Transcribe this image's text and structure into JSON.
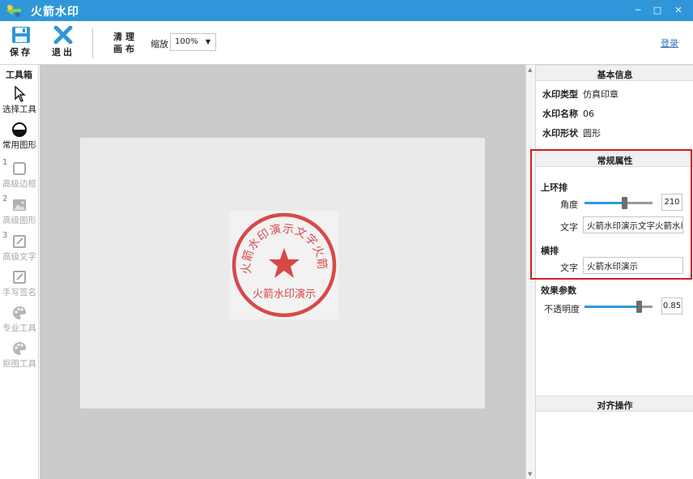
{
  "app": {
    "title": "火箭水印"
  },
  "window_controls": {
    "minimize": "─",
    "maximize": "□",
    "close": "✕"
  },
  "toolbar": {
    "save_label": "保存",
    "exit_label": "退出",
    "clear_label_1": "清理",
    "clear_label_2": "画布",
    "zoom_label": "缩放",
    "zoom_value": "100%",
    "login_label": "登录"
  },
  "toolbox": {
    "title": "工具箱",
    "items": [
      {
        "label": "选择工具",
        "icon": "cursor-arrow-icon",
        "enabled": true
      },
      {
        "label": "常用图形",
        "icon": "circle-shape-icon",
        "enabled": true
      },
      {
        "label": "高级边框",
        "icon": "square-frame-icon",
        "enabled": false,
        "number": "1"
      },
      {
        "label": "高级图形",
        "icon": "image-icon",
        "enabled": false,
        "number": "2"
      },
      {
        "label": "高级文字",
        "icon": "edit-text-icon",
        "enabled": false,
        "number": "3"
      },
      {
        "label": "手写签名",
        "icon": "pen-signature-icon",
        "enabled": false
      },
      {
        "label": "专业工具",
        "icon": "palette-icon",
        "enabled": false
      },
      {
        "label": "抠图工具",
        "icon": "palette-cutout-icon",
        "enabled": false
      }
    ]
  },
  "canvas": {
    "stamp": {
      "top_text": "火箭水印演示文字火箭水印",
      "bottom_text": "火箭水印演示",
      "color": "#d42a2a"
    }
  },
  "panel": {
    "basic_info": {
      "title": "基本信息",
      "rows": [
        {
          "label": "水印类型",
          "value": "仿真印章"
        },
        {
          "label": "水印名称",
          "value": "06"
        },
        {
          "label": "水印形状",
          "value": "圆形"
        }
      ]
    },
    "general_props": {
      "title": "常规属性",
      "upper_ring": {
        "title": "上环排",
        "angle_label": "角度",
        "angle_value": "210",
        "angle_fraction": 0.58,
        "text_label": "文字",
        "text_value": "火箭水印演示文字火箭水印"
      },
      "horizontal": {
        "title": "横排",
        "text_label": "文字",
        "text_value": "火箭水印演示"
      }
    },
    "effects": {
      "title": "效果参数",
      "opacity_label": "不透明度",
      "opacity_value": "0.85",
      "opacity_fraction": 0.85
    },
    "align": {
      "title": "对齐操作"
    }
  },
  "colors": {
    "accent": "#2f97d9",
    "highlight_border": "#d01f1f",
    "stamp": "#d42a2a"
  }
}
